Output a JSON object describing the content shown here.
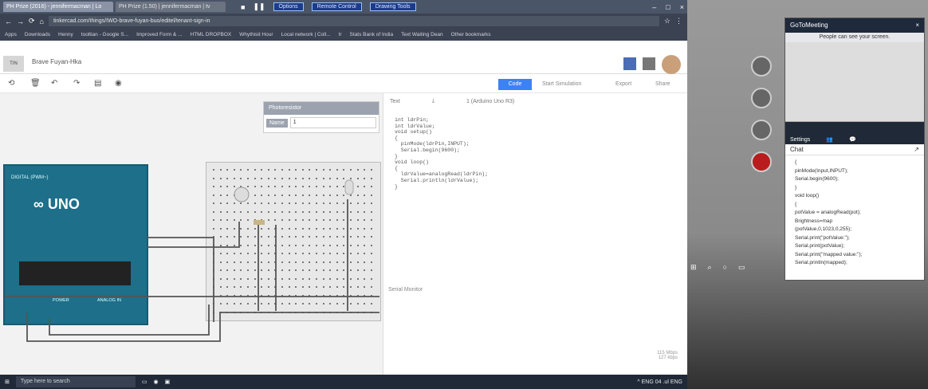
{
  "titlebar": {
    "tabs": [
      "PH Prize (2016) - jennifermacman | Lo",
      "PH Prize (1.50) | jennifermacman | tv"
    ],
    "remote_controls": [
      "Options",
      "Remote Control",
      "Drawing Tools"
    ],
    "window_buttons": [
      "–",
      "□",
      "×"
    ]
  },
  "address": {
    "url": "tinkercad.com/things/IWO-brave-fuyan-buo/editel/tenant-sign-in"
  },
  "bookmarks": [
    "Apps",
    "Downloads",
    "Henny",
    "tooltian - Google S...",
    "Improved Form & ...",
    "HTML DROPBOX",
    "Whythisit Hour",
    "Local network | Coll...",
    "Ir",
    "Stats Bank of India",
    "Text Waiting Dean",
    "Other bookmarks"
  ],
  "app": {
    "project_name": "Brave Fuyan-Hka"
  },
  "canvas_toolbar": {
    "code_button": "Code",
    "start_sim": "Start Simulation",
    "export": "Export",
    "share": "Share"
  },
  "photoresistor": {
    "title": "Photoresistor",
    "name_label": "Name",
    "name_value": "1"
  },
  "code_panel": {
    "mode": "Text",
    "board": "1 (Arduino Uno R3)",
    "code": "int ldrPin;\nint ldrValue;\nvoid setup()\n{\n  pinMode(ldrPin,INPUT);\n  Serial.begin(9600);\n}\nvoid loop()\n{\n  ldrValue=analogRead(ldrPin);\n  Serial.println(ldrValue);\n}",
    "serial_monitor": "Serial Monitor",
    "baud_rate": "115 Mbps\n127 kbps"
  },
  "arduino": {
    "brand": "UNO",
    "pwm_label": "DIGITAL (PWM~)",
    "power_label": "POWER",
    "analog_label": "ANALOG IN"
  },
  "taskbar": {
    "search_placeholder": "Type here to search",
    "tray": "^ ENG 04 .ul ENG"
  },
  "meeting": {
    "title": "GoToMeeting",
    "notice": "People can see your screen.",
    "settings": "Settings",
    "chat_title": "Chat",
    "chat_text": "{\npinMode(Input,INPUT);\nSerial.begin(9600);\n}\nvoid loop()\n{\npotValue = analogRead(pot);\nBrightness=map\n(potValue,0,1023,0,255);\nSerial.print(\"potValue:\");\nSerial.print(potValue);\nSerial.print(\"mapped value:\");\nSerial.println(mapped);"
  }
}
